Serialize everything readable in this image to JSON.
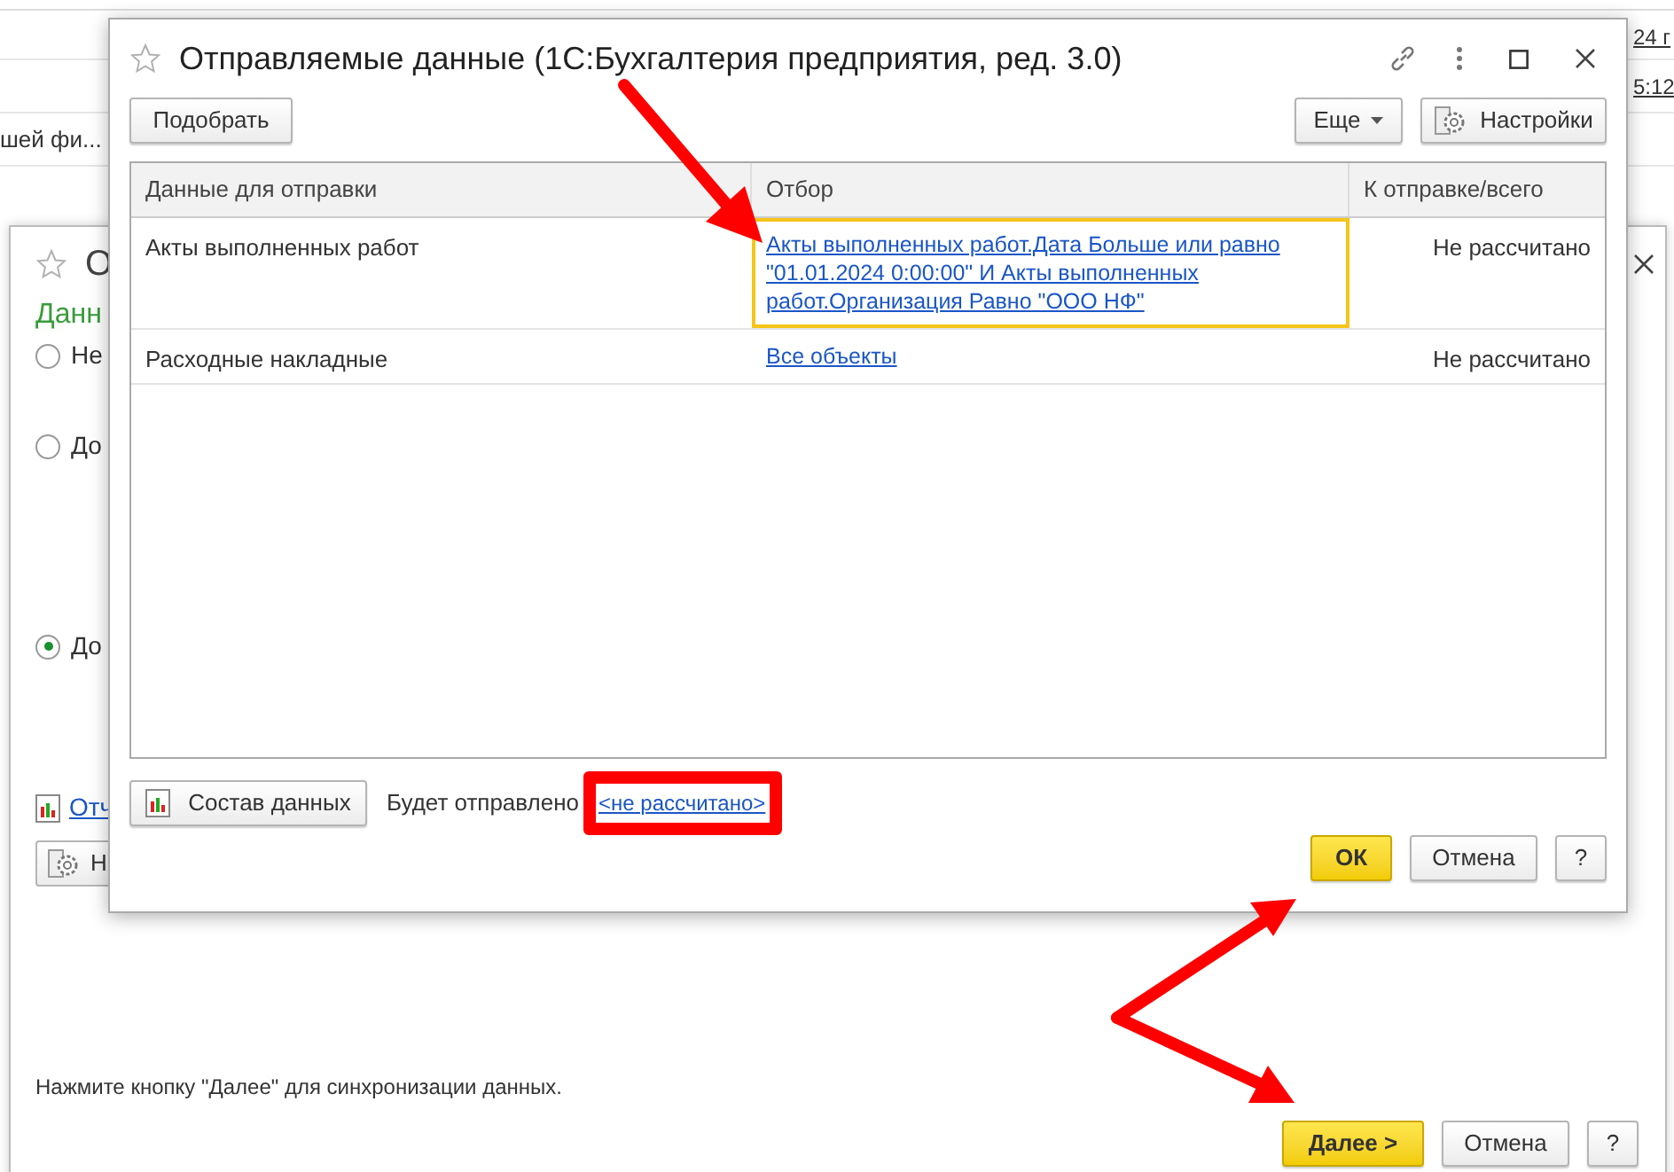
{
  "background_app": {
    "row_text": "шей фи...",
    "right_texts": [
      "24 г",
      "5:12"
    ]
  },
  "background_dialog": {
    "title": "О",
    "section_label": "Данн",
    "options": [
      {
        "label": "Не",
        "selected": false
      },
      {
        "label": "До",
        "selected": false
      },
      {
        "label": "До",
        "selected": true
      }
    ],
    "report_link": "Отч",
    "settings_button": "Н",
    "hint": "Нажмите кнопку \"Далее\" для синхронизации данных.",
    "buttons": [
      {
        "label": "Далее >",
        "kind": "primary"
      },
      {
        "label": "Отмена",
        "kind": "default"
      },
      {
        "label": "?",
        "kind": "default"
      }
    ]
  },
  "dialog": {
    "title": "Отправляемые данные (1С:Бухгалтерия предприятия, ред. 3.0)",
    "pick_button": "Подобрать",
    "more_button": "Еще",
    "settings_button": "Настройки",
    "table": {
      "columns": [
        "Данные для отправки",
        "Отбор",
        "К отправке/всего"
      ],
      "rows": [
        {
          "name": "Акты выполненных работ",
          "filter": "Акты выполненных работ.Дата Больше или равно \"01.01.2024 0:00:00\" И Акты выполненных работ.Организация Равно \"ООО НФ\"",
          "count": "Не рассчитано",
          "selected": true
        },
        {
          "name": "Расходные накладные",
          "filter": "Все объекты",
          "count": "Не рассчитано",
          "selected": false
        }
      ]
    },
    "compose_button": "Состав данных",
    "will_send_label": "Будет отправлено",
    "will_send_link": "<не рассчитано>",
    "buttons": [
      {
        "label": "ОК",
        "kind": "primary"
      },
      {
        "label": "Отмена",
        "kind": "default"
      },
      {
        "label": "?",
        "kind": "default"
      }
    ]
  }
}
